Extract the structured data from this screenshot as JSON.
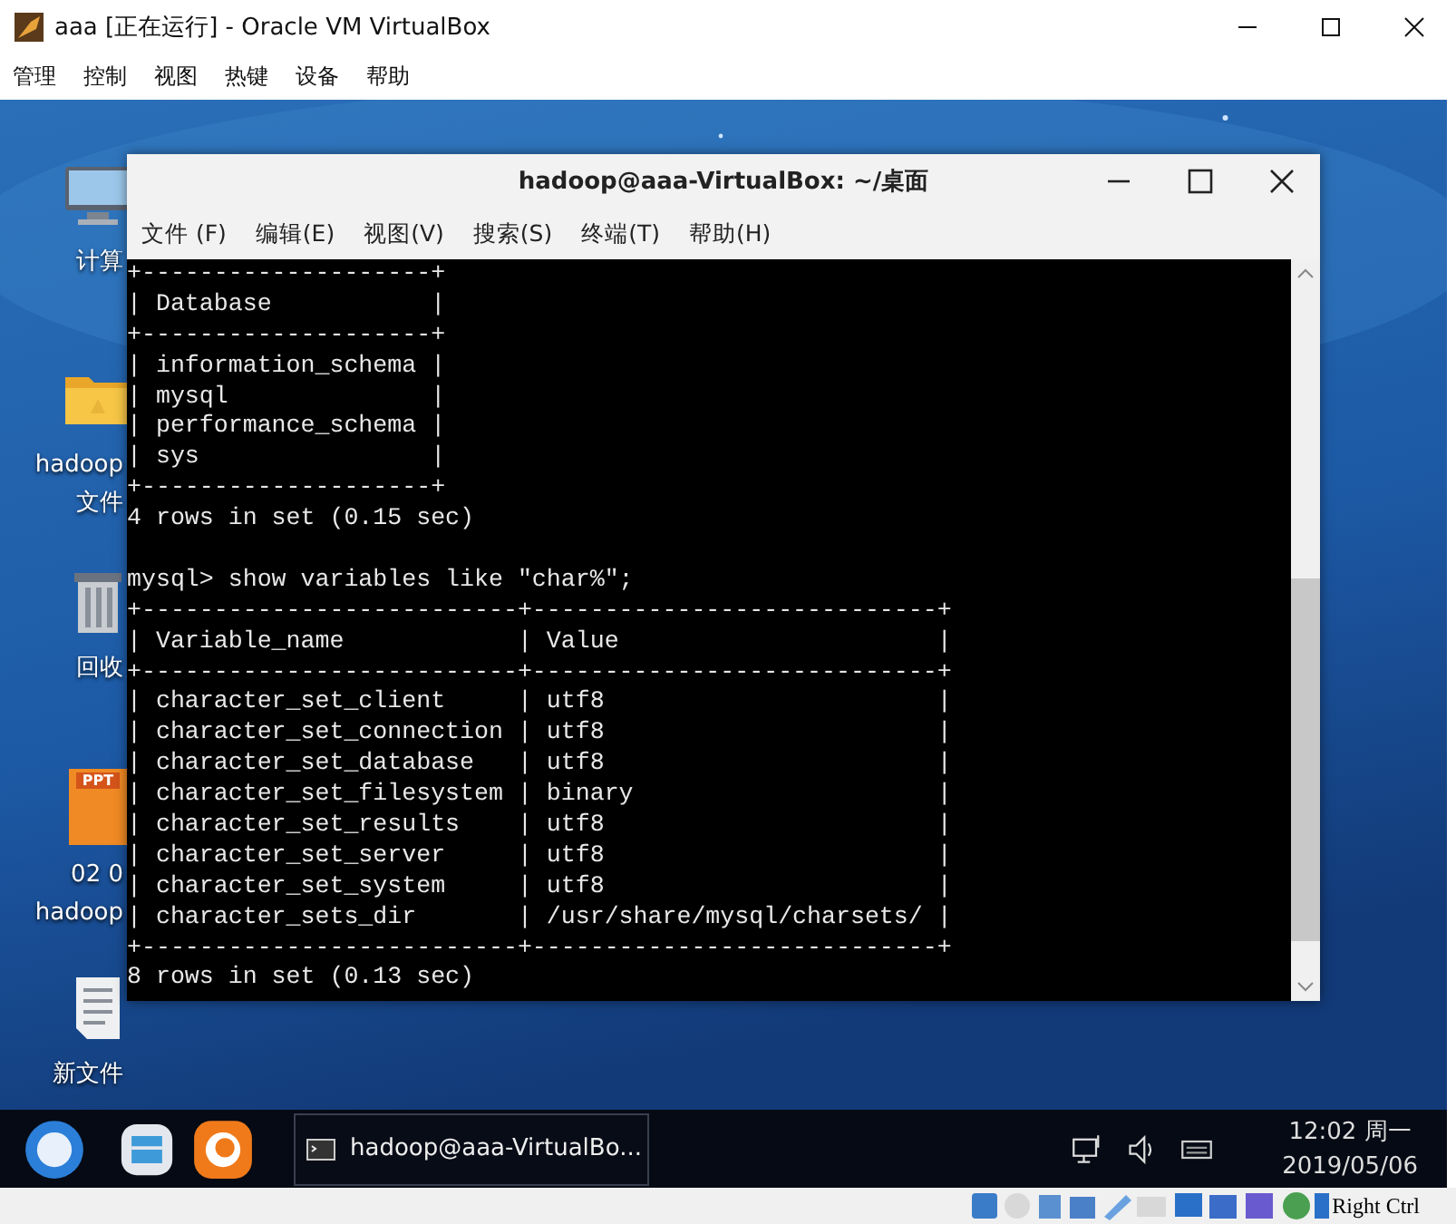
{
  "window": {
    "title": "aaa [正在运行] - Oracle VM VirtualBox"
  },
  "menu": [
    "管理",
    "控制",
    "视图",
    "热键",
    "设备",
    "帮助"
  ],
  "desktop": {
    "icons": [
      {
        "kind": "computer",
        "label": [
          "计算"
        ]
      },
      {
        "kind": "folder",
        "label": [
          "hadoop",
          "文件"
        ]
      },
      {
        "kind": "trash",
        "label": [
          "回收"
        ]
      },
      {
        "kind": "slides",
        "badge": "PPT",
        "label": [
          "02 0",
          "hadoop"
        ]
      },
      {
        "kind": "document",
        "label": [
          "新文件"
        ]
      }
    ]
  },
  "terminal": {
    "title": "hadoop@aaa-VirtualBox: ~/桌面",
    "menu": [
      "文件 (F)",
      "编辑(E)",
      "视图(V)",
      "搜索(S)",
      "终端(T)",
      "帮助(H)"
    ],
    "blocks": [
      [
        "+--------------------+",
        "| Database           |",
        "+--------------------+",
        "| information_schema |",
        "| mysql              |",
        "| performance_schema |",
        "| sys                |",
        "+--------------------+",
        "4 rows in set (0.15 sec)"
      ],
      [
        "mysql> show variables like \"char%\";",
        "+--------------------------+----------------------------+",
        "| Variable_name            | Value                      |",
        "+--------------------------+----------------------------+",
        "| character_set_client     | utf8                       |",
        "| character_set_connection | utf8                       |",
        "| character_set_database   | utf8                       |",
        "| character_set_filesystem | binary                     |",
        "| character_set_results    | utf8                       |",
        "| character_set_server     | utf8                       |",
        "| character_set_system     | utf8                       |",
        "| character_sets_dir       | /usr/share/mysql/charsets/ |",
        "+--------------------------+----------------------------+",
        "8 rows in set (0.13 sec)"
      ]
    ]
  },
  "taskbar": {
    "launchers": [
      {
        "kind": "uk"
      },
      {
        "kind": "files"
      },
      {
        "kind": "browser"
      }
    ],
    "tasks": [
      {
        "label": "hadoop@aaa-VirtualBo..."
      }
    ],
    "clock": {
      "time": "12:02 周一",
      "date": "2019/05/06"
    }
  },
  "status_bar": {
    "host_key": "Right Ctrl"
  }
}
